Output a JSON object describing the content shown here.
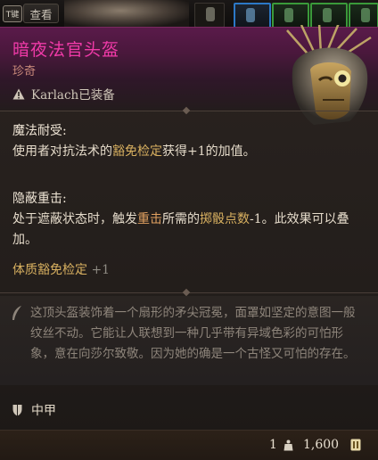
{
  "topbar": {
    "key_hint": "T键",
    "view_label": "查看"
  },
  "item": {
    "name": "暗夜法官头盔",
    "rarity": "珍奇",
    "equipped_by": "Karlach已装备",
    "name_color": "#f03aa8"
  },
  "abilities": [
    {
      "name": "魔法耐受:",
      "text_prefix": "使用者对抗法术的",
      "keyword": "豁免检定",
      "text_suffix": "获得+1的加值。"
    },
    {
      "name": "隐蔽重击:",
      "text_prefix": "处于遮蔽状态时，触发",
      "keyword": "重击",
      "text_mid": "所需的",
      "keyword2": "掷骰点数",
      "text_suffix": "-1。此效果可以叠加。"
    }
  ],
  "save_bonus": {
    "label": "体质豁免检定",
    "value": "+1"
  },
  "flavor_text": "这顶头盔装饰着一个扇形的矛尖冠冕，面罩如坚定的意图一般纹丝不动。它能让人联想到一种几乎带有异域色彩的可怕形象，意在向莎尔致敬。因为她的确是一个古怪又可怕的存在。",
  "armor_type": "中甲",
  "footer": {
    "weight": "1",
    "price": "1,600"
  },
  "icons": [
    "warning-icon",
    "quill-icon",
    "armor-icon",
    "weight-icon",
    "coin-icon",
    "helmet-image"
  ]
}
